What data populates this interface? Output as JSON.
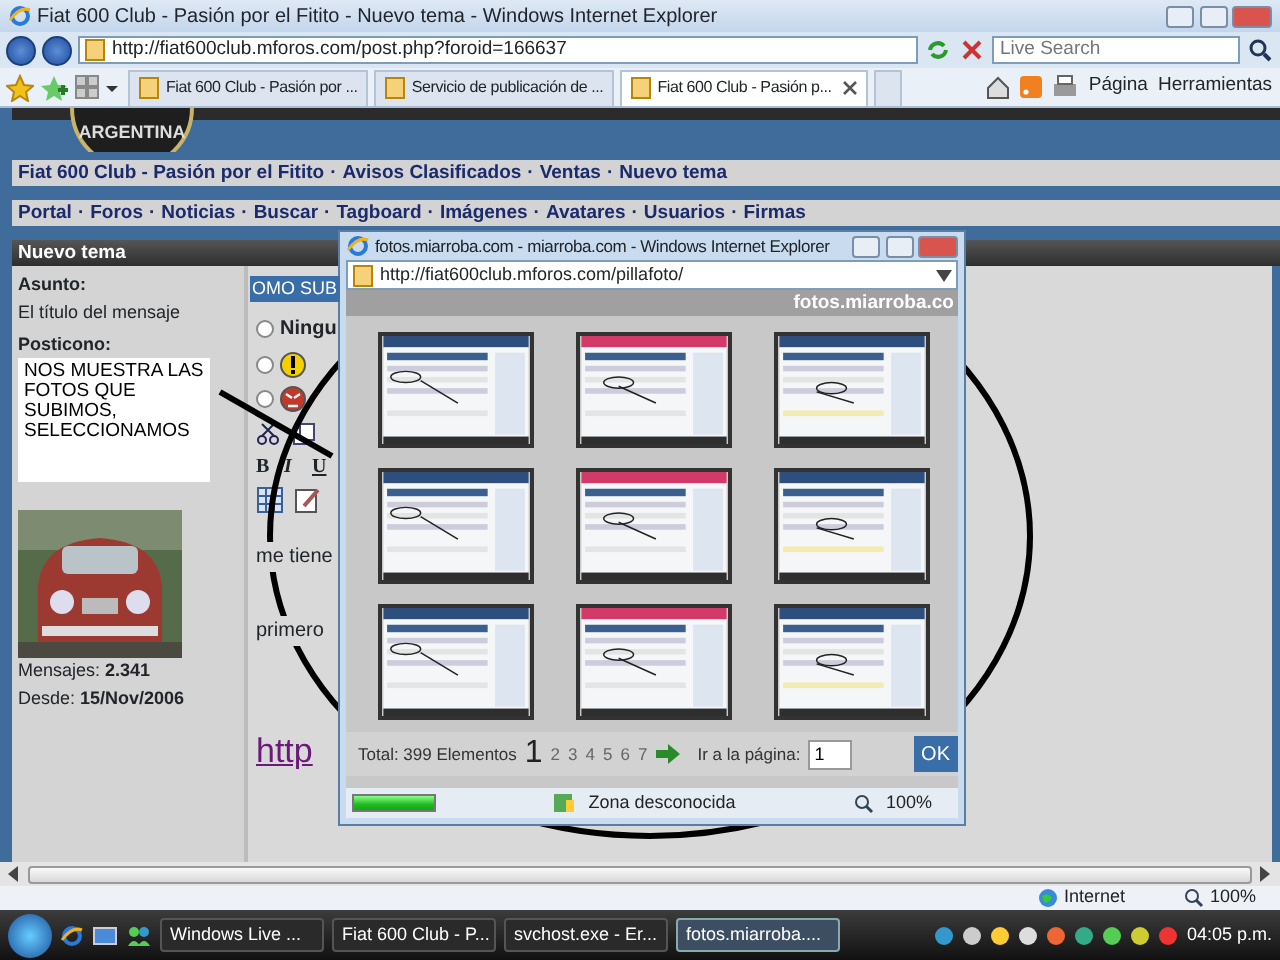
{
  "window": {
    "title": "Fiat 600 Club - Pasión por el Fitito - Nuevo tema - Windows Internet Explorer"
  },
  "address_bar": {
    "url": "http://fiat600club.mforos.com/post.php?foroid=166637"
  },
  "search": {
    "placeholder": "Live Search"
  },
  "tabs": [
    {
      "label": "Fiat 600 Club - Pasión por ...",
      "selected": false
    },
    {
      "label": "Servicio de publicación de ...",
      "selected": false
    },
    {
      "label": "Fiat 600 Club - Pasión p...",
      "selected": true
    }
  ],
  "command_bar": [
    "Página",
    "Herramientas"
  ],
  "page": {
    "logo_text": "ARGENTINA",
    "separator": "·",
    "breadcrumb": [
      "Fiat 600 Club - Pasión por el Fitito",
      "Avisos Clasificados",
      "Ventas",
      "Nuevo tema"
    ],
    "nav_links": [
      "Portal",
      "Foros",
      "Noticias",
      "Buscar",
      "Tagboard",
      "Imágenes",
      "Avatares",
      "Usuarios",
      "Firmas"
    ],
    "section_title": "Nuevo tema",
    "subject_label": "Asunto:",
    "subject_hint": "El título del mensaje",
    "subject_value": "OMO SUB",
    "posticon_label": "Posticono:",
    "posticons": [
      {
        "kind": "text",
        "label": "Ningu",
        "selected": false
      },
      {
        "kind": "warning",
        "selected": false
      },
      {
        "kind": "angry",
        "selected": false
      }
    ],
    "format_buttons": [
      "B",
      "I",
      "U"
    ],
    "message_lines": [
      "me tiene",
      "primero"
    ],
    "link_text": "http",
    "user_stats": [
      {
        "label": "Mensajes:",
        "value": "2.341"
      },
      {
        "label": "Desde:",
        "value": "15/Nov/2006"
      }
    ]
  },
  "annotation": {
    "text": "NOS MUESTRA LAS FOTOS QUE SUBIMOS, SELECCIONAMOS"
  },
  "popup": {
    "title": "fotos.miarroba.com - miarroba.com - Windows Internet Explorer",
    "url": "http://fiat600club.mforos.com/pillafoto/",
    "site_name": "fotos.miarroba.co",
    "total": "Total: 399 Elementos",
    "pages": [
      {
        "label": "1",
        "selected": true
      },
      {
        "label": "2",
        "selected": false
      },
      {
        "label": "3",
        "selected": false
      },
      {
        "label": "4",
        "selected": false
      },
      {
        "label": "5",
        "selected": false
      },
      {
        "label": "6",
        "selected": false
      },
      {
        "label": "7",
        "selected": false
      }
    ],
    "goto_label": "Ir a la página:",
    "goto_value": "1",
    "ok_button": "OK",
    "progress": {
      "level": 1
    },
    "zone": "Zona desconocida",
    "zoom": "100%"
  },
  "status_bar": {
    "zone": "Internet",
    "zoom": "100%"
  },
  "taskbar": {
    "tasks": [
      {
        "label": "Windows Live ...",
        "selected": false
      },
      {
        "label": "Fiat 600 Club - P...",
        "selected": false
      },
      {
        "label": "svchost.exe - Er...",
        "selected": false
      },
      {
        "label": "fotos.miarroba....",
        "selected": true
      }
    ],
    "clock": "04:05 p.m."
  }
}
